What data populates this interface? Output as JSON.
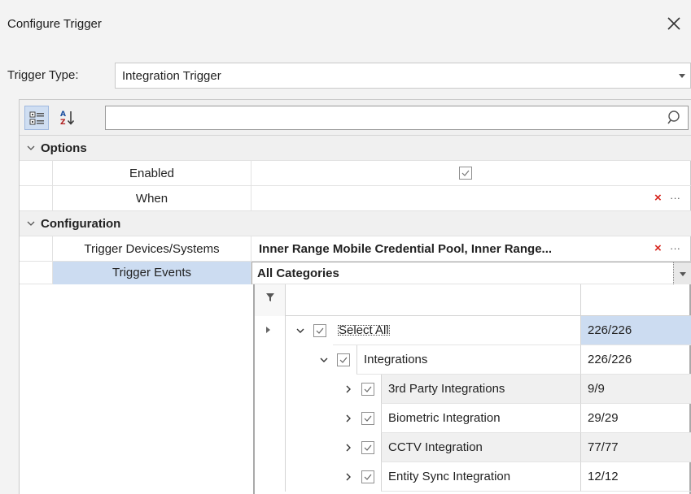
{
  "window": {
    "title": "Configure Trigger"
  },
  "trigger_type": {
    "label": "Trigger Type:",
    "value": "Integration Trigger"
  },
  "toolbar": {
    "search_value": ""
  },
  "categories": {
    "options": "Options",
    "configuration": "Configuration"
  },
  "properties": {
    "enabled": {
      "label": "Enabled",
      "checked": true
    },
    "when": {
      "label": "When",
      "value": ""
    },
    "devices": {
      "label": "Trigger Devices/Systems",
      "value": "Inner Range Mobile Credential Pool, Inner Range..."
    },
    "events": {
      "label": "Trigger Events",
      "value": "All Categories"
    }
  },
  "actions": {
    "clear": "×",
    "more": "···"
  },
  "event_tree": [
    {
      "label": "Select All",
      "count": "226/226",
      "checked": true,
      "expanded": true,
      "level": 0
    },
    {
      "label": "Integrations",
      "count": "226/226",
      "checked": true,
      "expanded": true,
      "level": 1
    },
    {
      "label": "3rd Party Integrations",
      "count": "9/9",
      "checked": true,
      "expanded": false,
      "level": 2
    },
    {
      "label": "Biometric Integration",
      "count": "29/29",
      "checked": true,
      "expanded": false,
      "level": 2
    },
    {
      "label": "CCTV Integration",
      "count": "77/77",
      "checked": true,
      "expanded": false,
      "level": 2
    },
    {
      "label": "Entity Sync Integration",
      "count": "12/12",
      "checked": true,
      "expanded": false,
      "level": 2
    }
  ]
}
